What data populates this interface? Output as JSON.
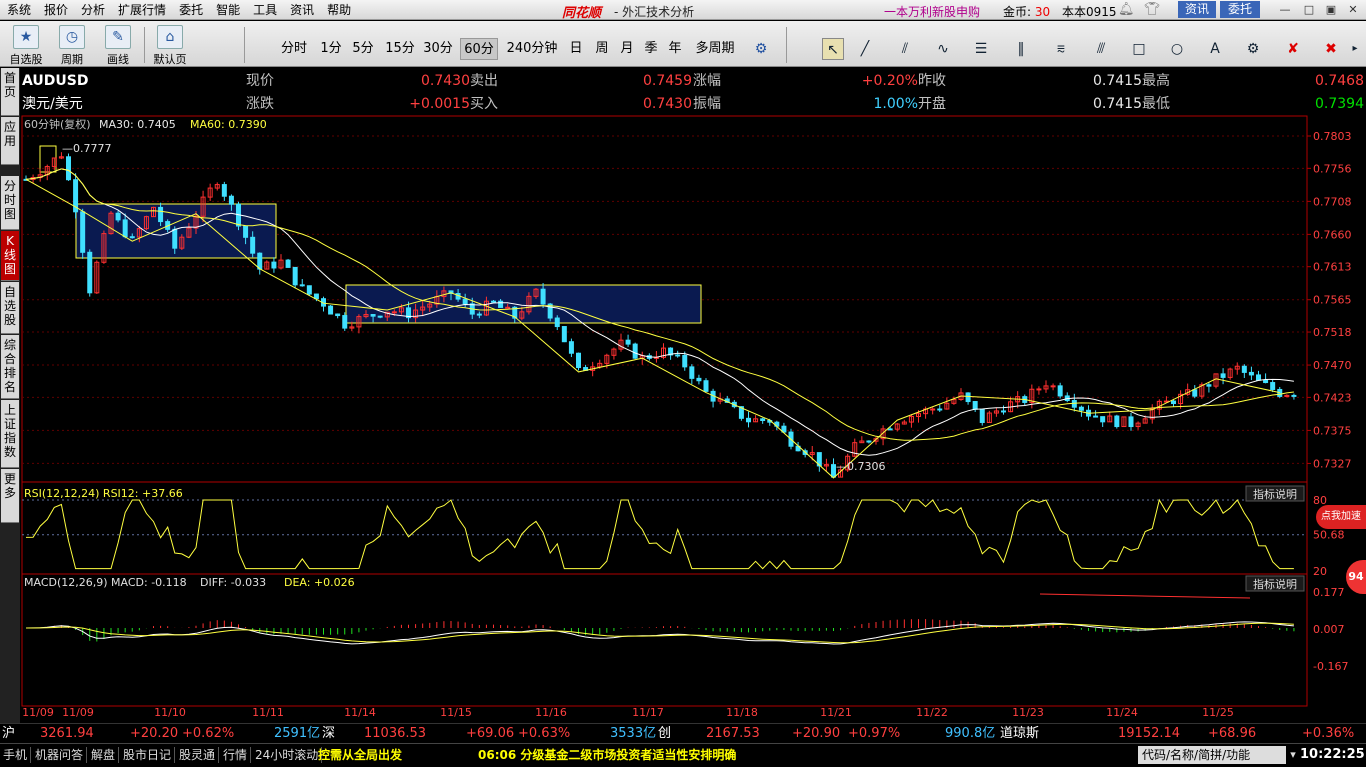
{
  "menu": [
    "系统",
    "报价",
    "分析",
    "扩展行情",
    "委托",
    "智能",
    "工具",
    "资讯",
    "帮助"
  ],
  "brand": "同花顺",
  "app_title": "- 外汇技术分析",
  "promo": "一本万利新股申购",
  "coins_label": "金币:",
  "coins_value": "30",
  "version": "本本0915",
  "zixun": "资讯",
  "weituo": "委托",
  "toolbar": {
    "btn1": "自选股",
    "btn2": "周期",
    "btn3": "画线",
    "btn4": "默认页",
    "periods": [
      "分时",
      "1分",
      "5分",
      "15分",
      "30分",
      "60分",
      "240分钟",
      "日",
      "周",
      "月",
      "季",
      "年",
      "多周期"
    ],
    "active_period": "60分"
  },
  "sidebar": [
    {
      "label": "首页",
      "active": false
    },
    {
      "label": "应用",
      "active": false
    },
    {
      "label": "分时图",
      "active": false
    },
    {
      "label": "K线图",
      "active": true
    },
    {
      "label": "自选股",
      "active": false
    },
    {
      "label": "综合排名",
      "active": false
    },
    {
      "label": "上证指数",
      "active": false
    },
    {
      "label": "更多",
      "active": false
    }
  ],
  "quote": {
    "symbol": "AUDUSD",
    "name": "澳元/美元",
    "row1": [
      {
        "label": "现价",
        "value": "0.7430",
        "color": "red"
      },
      {
        "label": "卖出",
        "value": "0.7459",
        "color": "red"
      },
      {
        "label": "涨幅",
        "value": "+0.20%",
        "color": "red"
      },
      {
        "label": "昨收",
        "value": "0.7415",
        "color": "white"
      },
      {
        "label": "最高",
        "value": "0.7468",
        "color": "red"
      }
    ],
    "row2": [
      {
        "label": "涨跌",
        "value": "+0.0015",
        "color": "red"
      },
      {
        "label": "买入",
        "value": "0.7430",
        "color": "red"
      },
      {
        "label": "振幅",
        "value": "1.00%",
        "color": "cyan"
      },
      {
        "label": "开盘",
        "value": "0.7415",
        "color": "white"
      },
      {
        "label": "最低",
        "value": "0.7394",
        "color": "green"
      }
    ]
  },
  "chart_data": {
    "type": "candlestick",
    "title": "60分钟(复权)",
    "ma30_label": "MA30: 0.7405",
    "ma60_label": "MA60: 0.7390",
    "y_ticks": [
      "0.7803",
      "0.7756",
      "0.7708",
      "0.7660",
      "0.7613",
      "0.7565",
      "0.7518",
      "0.7470",
      "0.7423",
      "0.7375",
      "0.7327"
    ],
    "ylim": [
      0.73,
      0.7803
    ],
    "x_labels": [
      "11/09",
      "11/09",
      "11/10",
      "11/11",
      "11/14",
      "11/15",
      "11/16",
      "11/17",
      "11/18",
      "11/21",
      "11/22",
      "11/23",
      "11/24",
      "11/25"
    ],
    "annotations": {
      "high": "0.7777",
      "low": "0.7306"
    },
    "close_path": [
      [
        0,
        0.774
      ],
      [
        3,
        0.776
      ],
      [
        5,
        0.7777
      ],
      [
        7,
        0.77
      ],
      [
        9,
        0.758
      ],
      [
        12,
        0.769
      ],
      [
        15,
        0.765
      ],
      [
        18,
        0.77
      ],
      [
        21,
        0.764
      ],
      [
        24,
        0.769
      ],
      [
        27,
        0.774
      ],
      [
        30,
        0.768
      ],
      [
        33,
        0.761
      ],
      [
        36,
        0.762
      ],
      [
        39,
        0.758
      ],
      [
        42,
        0.756
      ],
      [
        45,
        0.753
      ],
      [
        48,
        0.754
      ],
      [
        51,
        0.755
      ],
      [
        54,
        0.7545
      ],
      [
        57,
        0.756
      ],
      [
        60,
        0.7575
      ],
      [
        63,
        0.7545
      ],
      [
        66,
        0.756
      ],
      [
        69,
        0.754
      ],
      [
        72,
        0.7575
      ],
      [
        75,
        0.753
      ],
      [
        78,
        0.746
      ],
      [
        81,
        0.748
      ],
      [
        84,
        0.75
      ],
      [
        87,
        0.748
      ],
      [
        90,
        0.749
      ],
      [
        93,
        0.747
      ],
      [
        96,
        0.743
      ],
      [
        99,
        0.741
      ],
      [
        102,
        0.739
      ],
      [
        105,
        0.739
      ],
      [
        108,
        0.736
      ],
      [
        111,
        0.734
      ],
      [
        114,
        0.7306
      ],
      [
        117,
        0.735
      ],
      [
        120,
        0.737
      ],
      [
        123,
        0.739
      ],
      [
        126,
        0.74
      ],
      [
        129,
        0.741
      ],
      [
        132,
        0.7425
      ],
      [
        135,
        0.739
      ],
      [
        138,
        0.741
      ],
      [
        141,
        0.742
      ],
      [
        144,
        0.7445
      ],
      [
        147,
        0.7425
      ],
      [
        150,
        0.74
      ],
      [
        153,
        0.739
      ],
      [
        156,
        0.7385
      ],
      [
        159,
        0.7405
      ],
      [
        162,
        0.742
      ],
      [
        165,
        0.743
      ],
      [
        168,
        0.745
      ],
      [
        171,
        0.7465
      ],
      [
        174,
        0.7445
      ],
      [
        177,
        0.743
      ]
    ],
    "rsi_label": "RSI(12,12,24) RSI12: +37.66",
    "rsi_ticks": [
      "80",
      "50.68",
      "20"
    ],
    "macd_label": "MACD(12,26,9) MACD: -0.118",
    "diff_label": "DIFF: -0.033",
    "dea_label": "DEA: +0.026",
    "macd_ticks": [
      "0.177",
      "0.007",
      "-0.167"
    ],
    "indicator_btn": "指标说明"
  },
  "status": [
    {
      "text": "沪",
      "color": "#fff"
    },
    {
      "text": "3261.94",
      "color": "#ff4040"
    },
    {
      "text": "+20.20",
      "color": "#ff4040"
    },
    {
      "text": "+0.62%",
      "color": "#ff4040"
    },
    {
      "text": "2591亿",
      "color": "#40c0ff"
    },
    {
      "text": "深",
      "color": "#fff"
    },
    {
      "text": "11036.53",
      "color": "#ff4040"
    },
    {
      "text": "+69.06",
      "color": "#ff4040"
    },
    {
      "text": "+0.63%",
      "color": "#ff4040"
    },
    {
      "text": "3533亿",
      "color": "#40c0ff"
    },
    {
      "text": "创",
      "color": "#fff"
    },
    {
      "text": "2167.53",
      "color": "#ff4040"
    },
    {
      "text": "+20.90",
      "color": "#ff4040"
    },
    {
      "text": "+0.97%",
      "color": "#ff4040"
    },
    {
      "text": "990.8亿",
      "color": "#40c0ff"
    },
    {
      "text": "道琼斯",
      "color": "#fff"
    },
    {
      "text": "19152.14",
      "color": "#ff4040"
    },
    {
      "text": "+68.96",
      "color": "#ff4040"
    },
    {
      "text": "+0.36%",
      "color": "#ff4040"
    }
  ],
  "bottom_tabs": [
    "手机",
    "机器问答",
    "解盘",
    "股市日记",
    "股灵通",
    "行情",
    "24小时滚动"
  ],
  "ticker1": "控需从全局出发",
  "ticker2": "06:06 分级基金二级市场投资者适当性安排明确",
  "search_placeholder": "代码/名称/简拼/功能",
  "clock": "10:22:25",
  "badge": "点我加速",
  "badge_value": "94"
}
